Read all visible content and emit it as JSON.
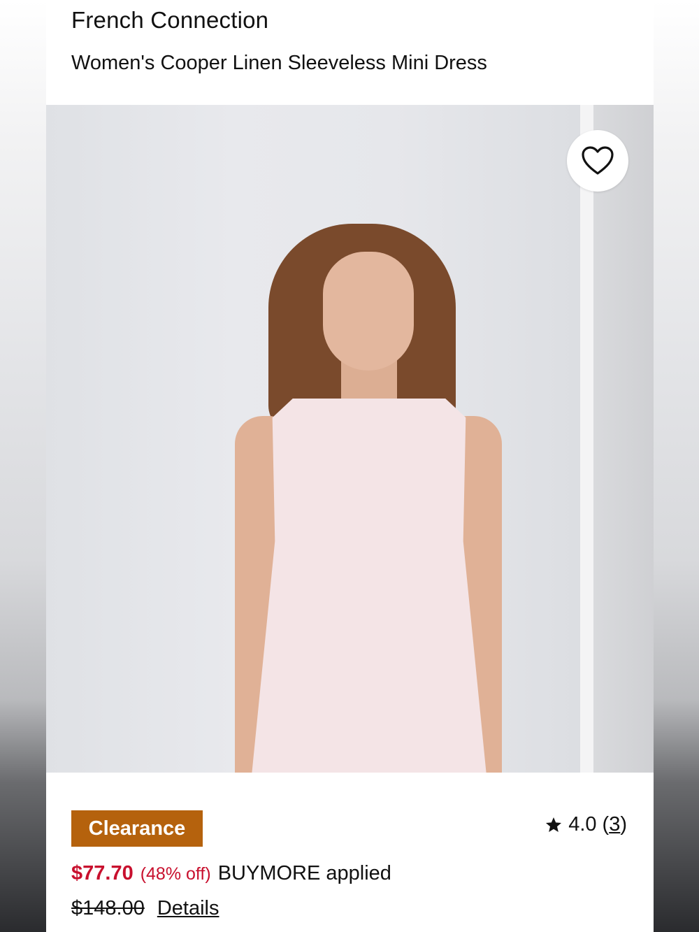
{
  "product": {
    "brand": "French Connection",
    "title": "Women's Cooper Linen Sleeveless Mini Dress",
    "image_alt": "Model wearing a pale pink sleeveless linen mini dress"
  },
  "badge": {
    "label": "Clearance",
    "color": "#b5620d"
  },
  "rating": {
    "icon": "star-icon",
    "value": "4.0",
    "open_paren": "(",
    "count": "3",
    "close_paren": ")"
  },
  "pricing": {
    "sale_price": "$77.70",
    "discount": "(48% off)",
    "promo": "BUYMORE applied",
    "original_price": "$148.00",
    "details_label": "Details",
    "sale_color": "#c8102e"
  },
  "favorite": {
    "icon": "heart-icon"
  }
}
